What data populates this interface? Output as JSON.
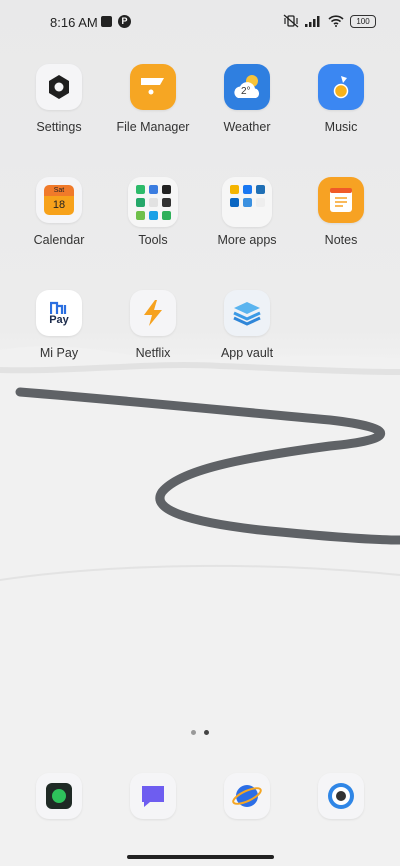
{
  "status_bar": {
    "time": "8:16 AM",
    "battery": "100",
    "icons": [
      "stop-icon",
      "p-badge-icon",
      "vibrate-off-icon",
      "signal-icon",
      "wifi-icon",
      "battery-icon"
    ]
  },
  "apps": [
    {
      "label": "Settings",
      "icon": "gear-icon"
    },
    {
      "label": "File Manager",
      "icon": "folder-icon"
    },
    {
      "label": "Weather",
      "icon": "weather-icon",
      "temp": "2°"
    },
    {
      "label": "Music",
      "icon": "music-note-icon"
    },
    {
      "label": "Calendar",
      "icon": "calendar-icon",
      "day": "Sat",
      "date": "18"
    },
    {
      "label": "Tools",
      "icon": "folder-grid-icon"
    },
    {
      "label": "More apps",
      "icon": "folder-grid-icon"
    },
    {
      "label": "Notes",
      "icon": "notes-icon"
    },
    {
      "label": "Mi Pay",
      "icon": "mi-pay-icon",
      "logo_text": "Pay"
    },
    {
      "label": "Netflix",
      "icon": "lightning-icon"
    },
    {
      "label": "App vault",
      "icon": "layers-icon"
    }
  ],
  "pager": {
    "pages": 2,
    "active": 2
  },
  "dock": [
    {
      "icon": "phone-icon"
    },
    {
      "icon": "messages-icon"
    },
    {
      "icon": "browser-icon"
    },
    {
      "icon": "camera-icon"
    }
  ]
}
